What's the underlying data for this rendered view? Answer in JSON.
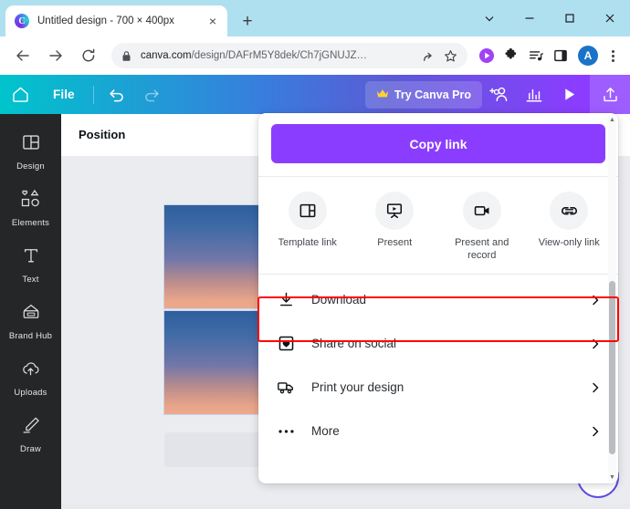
{
  "browser": {
    "tab": {
      "title": "Untitled design - 700 × 400px",
      "favicon": "canva-logo-icon",
      "close": "×"
    },
    "new_tab_label": "+",
    "window_controls": [
      {
        "name": "tab-search-chevron",
        "glyph": "⌄"
      },
      {
        "name": "minimize",
        "glyph": "—"
      },
      {
        "name": "maximize",
        "glyph": "□"
      },
      {
        "name": "close",
        "glyph": "✕"
      }
    ],
    "nav": {
      "back": "←",
      "forward": "→",
      "reload": "⟳"
    },
    "omnibox": {
      "lock_icon": "lock-icon",
      "url_host": "canva.com",
      "url_path": "/design/DAFrM5Y8dek/Ch7jGNUJZ…",
      "share_icon": "share-page-icon",
      "bookmark_icon": "star-icon"
    },
    "toolbar_icons": [
      {
        "name": "media-play-extension-icon",
        "color": "#a142f4"
      },
      {
        "name": "extensions-puzzle-icon",
        "color": "#202124"
      },
      {
        "name": "media-playlist-icon",
        "color": "#202124"
      },
      {
        "name": "side-panel-icon",
        "color": "#202124"
      }
    ],
    "avatar_letter": "A",
    "menu_icon": "kebab-menu-icon"
  },
  "canva_header": {
    "home_icon": "home-icon",
    "file_label": "File",
    "undo_icon": "undo-icon",
    "redo_icon": "redo-icon",
    "pro_button": {
      "label": "Try Canva Pro",
      "crown_icon": "crown-icon"
    },
    "collaborate_icon": "add-people-icon",
    "insights_icon": "bar-chart-icon",
    "present_icon": "play-icon",
    "share_icon": "upload-share-icon",
    "gradient": [
      "#00c4cc",
      "#5b5bd6",
      "#8b3dff"
    ]
  },
  "sidebar": {
    "items": [
      {
        "label": "Design",
        "icon": "layout-panels-icon"
      },
      {
        "label": "Elements",
        "icon": "shapes-icon"
      },
      {
        "label": "Text",
        "icon": "text-t-icon"
      },
      {
        "label": "Brand Hub",
        "icon": "brand-palette-icon"
      },
      {
        "label": "Uploads",
        "icon": "cloud-upload-icon"
      },
      {
        "label": "Draw",
        "icon": "pencil-draw-icon"
      }
    ]
  },
  "editor": {
    "position_label": "Position",
    "pages": [
      {
        "name": "page-thumbnail-1",
        "gradient": [
          "#2e5f9e",
          "#eca98c"
        ]
      },
      {
        "name": "page-thumbnail-2",
        "gradient": [
          "#2e5f9e",
          "#eca98c"
        ]
      }
    ],
    "help_button_icon": "help-circle-icon"
  },
  "share_panel": {
    "copy_link_label": "Copy link",
    "quick_actions": [
      {
        "label": "Template link",
        "icon": "template-layout-icon"
      },
      {
        "label": "Present",
        "icon": "presentation-play-icon"
      },
      {
        "label": "Present and record",
        "icon": "video-camera-icon"
      },
      {
        "label": "View-only link",
        "icon": "chain-link-icon"
      }
    ],
    "menu_items": [
      {
        "label": "Download",
        "icon": "download-arrow-icon",
        "chevron": "›",
        "highlighted": true
      },
      {
        "label": "Share on social",
        "icon": "heart-square-icon",
        "chevron": "›",
        "highlighted": false
      },
      {
        "label": "Print your design",
        "icon": "delivery-truck-icon",
        "chevron": "›",
        "highlighted": false
      },
      {
        "label": "More",
        "icon": "ellipsis-icon",
        "chevron": "›",
        "highlighted": false
      }
    ],
    "highlight_color": "#fe0000",
    "accent_color": "#8b3dff"
  }
}
